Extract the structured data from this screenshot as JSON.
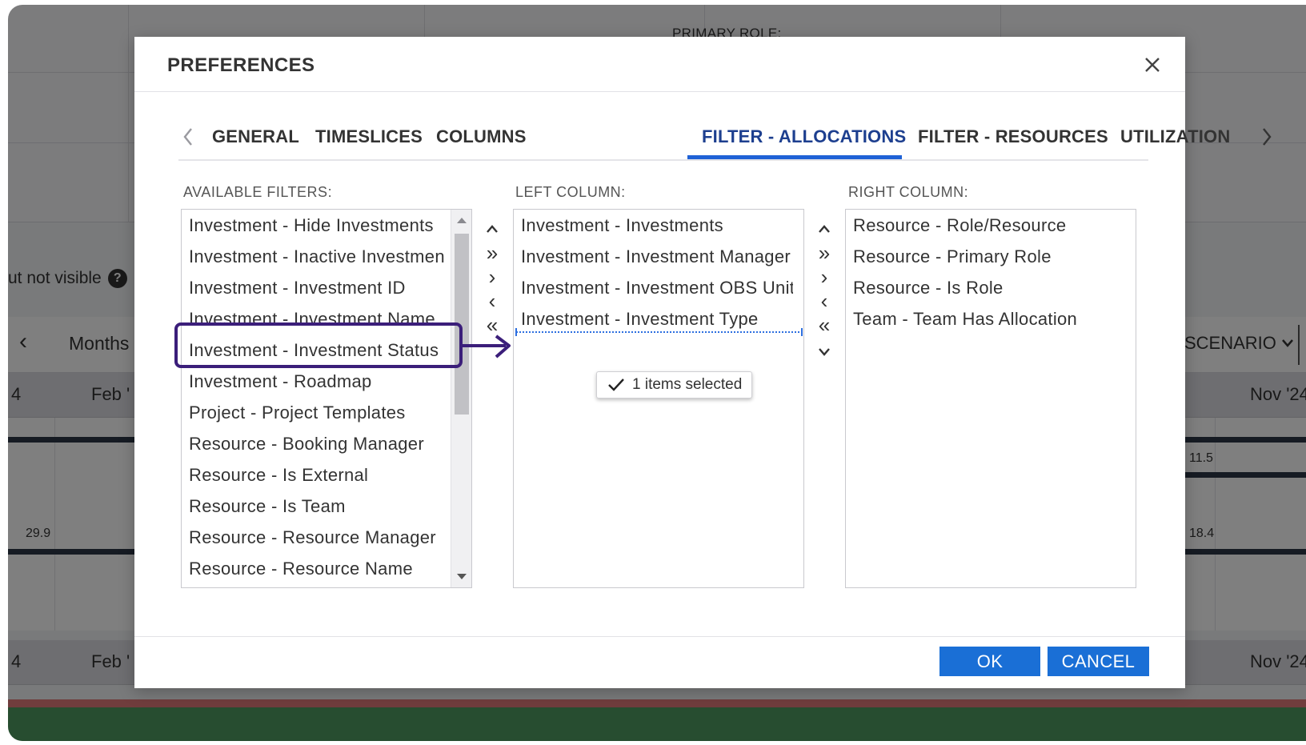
{
  "background": {
    "header_label": "PRIMARY ROLE:",
    "hidden_note": "ut not visible",
    "help_icon": "question-circle-icon",
    "toolbar": {
      "prev_icon": "chevron-left-icon",
      "period_label": "Months",
      "scenario_label": "SCENARIO",
      "scenario_icon": "chevron-down-icon"
    },
    "dates_top": [
      "4",
      "Feb '",
      "Nov '24"
    ],
    "dates_bottom": [
      "4",
      "Feb '",
      "Nov '24"
    ],
    "cell_values": [
      "29.9",
      "11.5",
      "18.4"
    ]
  },
  "modal": {
    "title": "PREFERENCES",
    "close_icon": "close-icon",
    "tabs": [
      {
        "label": "GENERAL",
        "active": false
      },
      {
        "label": "TIMESLICES",
        "active": false
      },
      {
        "label": "COLUMNS",
        "active": false
      },
      {
        "label": "FILTER - ALLOCATIONS",
        "active": true
      },
      {
        "label": "FILTER - RESOURCES",
        "active": false
      },
      {
        "label": "UTILIZATION",
        "active": false
      }
    ],
    "available": {
      "label": "AVAILABLE FILTERS:",
      "items": [
        "Investment - Hide Investments",
        "Investment - Inactive Investments",
        "Investment - Investment ID",
        "Investment - Investment Name",
        "Investment - Investment Status",
        "Investment - Roadmap",
        "Project - Project Templates",
        "Resource - Booking Manager",
        "Resource - Is External",
        "Resource - Is Team",
        "Resource - Resource Manager",
        "Resource - Resource Name"
      ]
    },
    "left_column": {
      "label": "LEFT COLUMN:",
      "items": [
        "Investment - Investments",
        "Investment - Investment Manager",
        "Investment - Investment OBS Unit",
        "Investment - Investment Type"
      ]
    },
    "right_column": {
      "label": "RIGHT COLUMN:",
      "items": [
        "Resource - Role/Resource",
        "Resource - Primary Role",
        "Resource - Is Role",
        "Team - Team Has Allocation"
      ]
    },
    "move_buttons": {
      "up": "^",
      "move_all_right": "»",
      "move_right": "›",
      "move_left": "‹",
      "move_all_left": "«",
      "down": "⌄"
    },
    "drag_tooltip": "1 items selected",
    "drag_tooltip_icon": "checkmark-icon",
    "ok_label": "OK",
    "cancel_label": "CANCEL"
  }
}
